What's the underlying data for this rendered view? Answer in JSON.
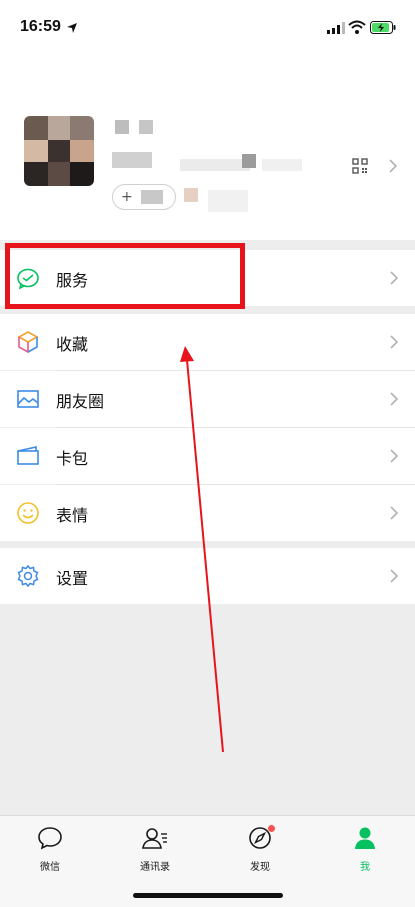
{
  "status_bar": {
    "time": "16:59"
  },
  "menu": {
    "service": "服务",
    "favorites": "收藏",
    "moments": "朋友圈",
    "cards": "卡包",
    "stickers": "表情",
    "settings": "设置"
  },
  "profile": {
    "status_plus": "+"
  },
  "tabbar": {
    "tabs": [
      {
        "label": "微信",
        "icon": "chat-icon"
      },
      {
        "label": "通讯录",
        "icon": "contacts-icon"
      },
      {
        "label": "发现",
        "icon": "compass-icon"
      },
      {
        "label": "我",
        "icon": "me-icon"
      }
    ],
    "active_tab": "我"
  },
  "colors": {
    "accent": "#07c160",
    "annotation": "#e8141b"
  }
}
